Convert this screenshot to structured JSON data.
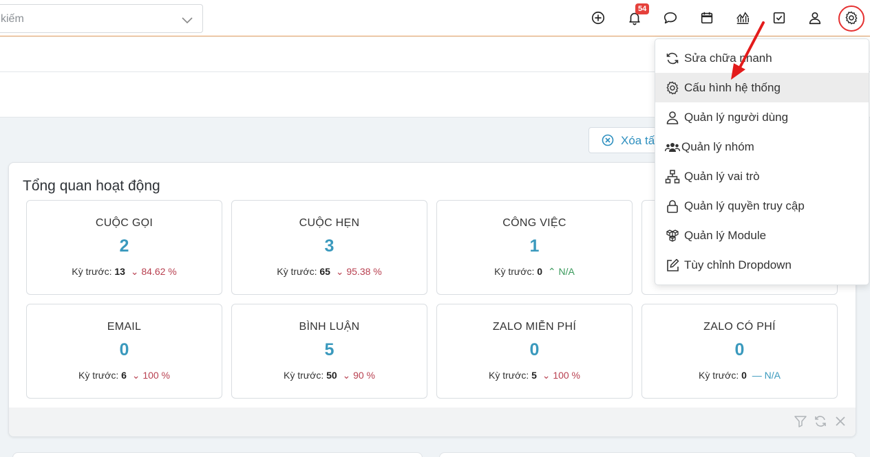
{
  "header": {
    "search_placeholder": "kiếm",
    "notification_count": "54",
    "icons": [
      "plus-circle-icon",
      "bell-icon",
      "chat-icon",
      "calendar-icon",
      "chart-icon",
      "checkbox-icon",
      "user-icon",
      "gear-icon"
    ]
  },
  "toolbar": {
    "clear_label": "Xóa tấ"
  },
  "panel": {
    "title": "Tổng quan hoạt động",
    "prev_label": "Kỳ trước:",
    "cards": [
      {
        "title": "CUỘC GỌI",
        "value": "2",
        "prev": "13",
        "change": "84.62 %",
        "trend": "down"
      },
      {
        "title": "CUỘC HẸN",
        "value": "3",
        "prev": "65",
        "change": "95.38 %",
        "trend": "down"
      },
      {
        "title": "CÔNG VIỆC",
        "value": "1",
        "prev": "0",
        "change": "N/A",
        "trend": "up"
      },
      {
        "title": "EMAIL",
        "value": "0",
        "prev": "6",
        "change": "100 %",
        "trend": "down"
      },
      {
        "title": "BÌNH LUẬN",
        "value": "5",
        "prev": "50",
        "change": "90 %",
        "trend": "down"
      },
      {
        "title": "ZALO MIỄN PHÍ",
        "value": "0",
        "prev": "5",
        "change": "100 %",
        "trend": "down"
      },
      {
        "title": "ZALO CÓ PHÍ",
        "value": "0",
        "prev": "0",
        "change": "N/A",
        "trend": "flat"
      }
    ]
  },
  "menu": {
    "items": [
      {
        "label": "Sửa chữa nhanh",
        "icon": "refresh-icon"
      },
      {
        "label": "Cấu hình hệ thống",
        "icon": "gear-icon",
        "active": true
      },
      {
        "label": "Quản lý người dùng",
        "icon": "user-icon"
      },
      {
        "label": "Quản lý nhóm",
        "icon": "users-icon"
      },
      {
        "label": "Quản lý vai trò",
        "icon": "hierarchy-icon"
      },
      {
        "label": "Quản lý quyền truy cập",
        "icon": "lock-icon"
      },
      {
        "label": "Quản lý Module",
        "icon": "boxes-icon"
      },
      {
        "label": "Tùy chỉnh Dropdown",
        "icon": "edit-icon"
      }
    ]
  },
  "colors": {
    "accent": "#3a99bd",
    "down": "#b84050",
    "up": "#3a9a5c",
    "highlight": "#e53030"
  }
}
